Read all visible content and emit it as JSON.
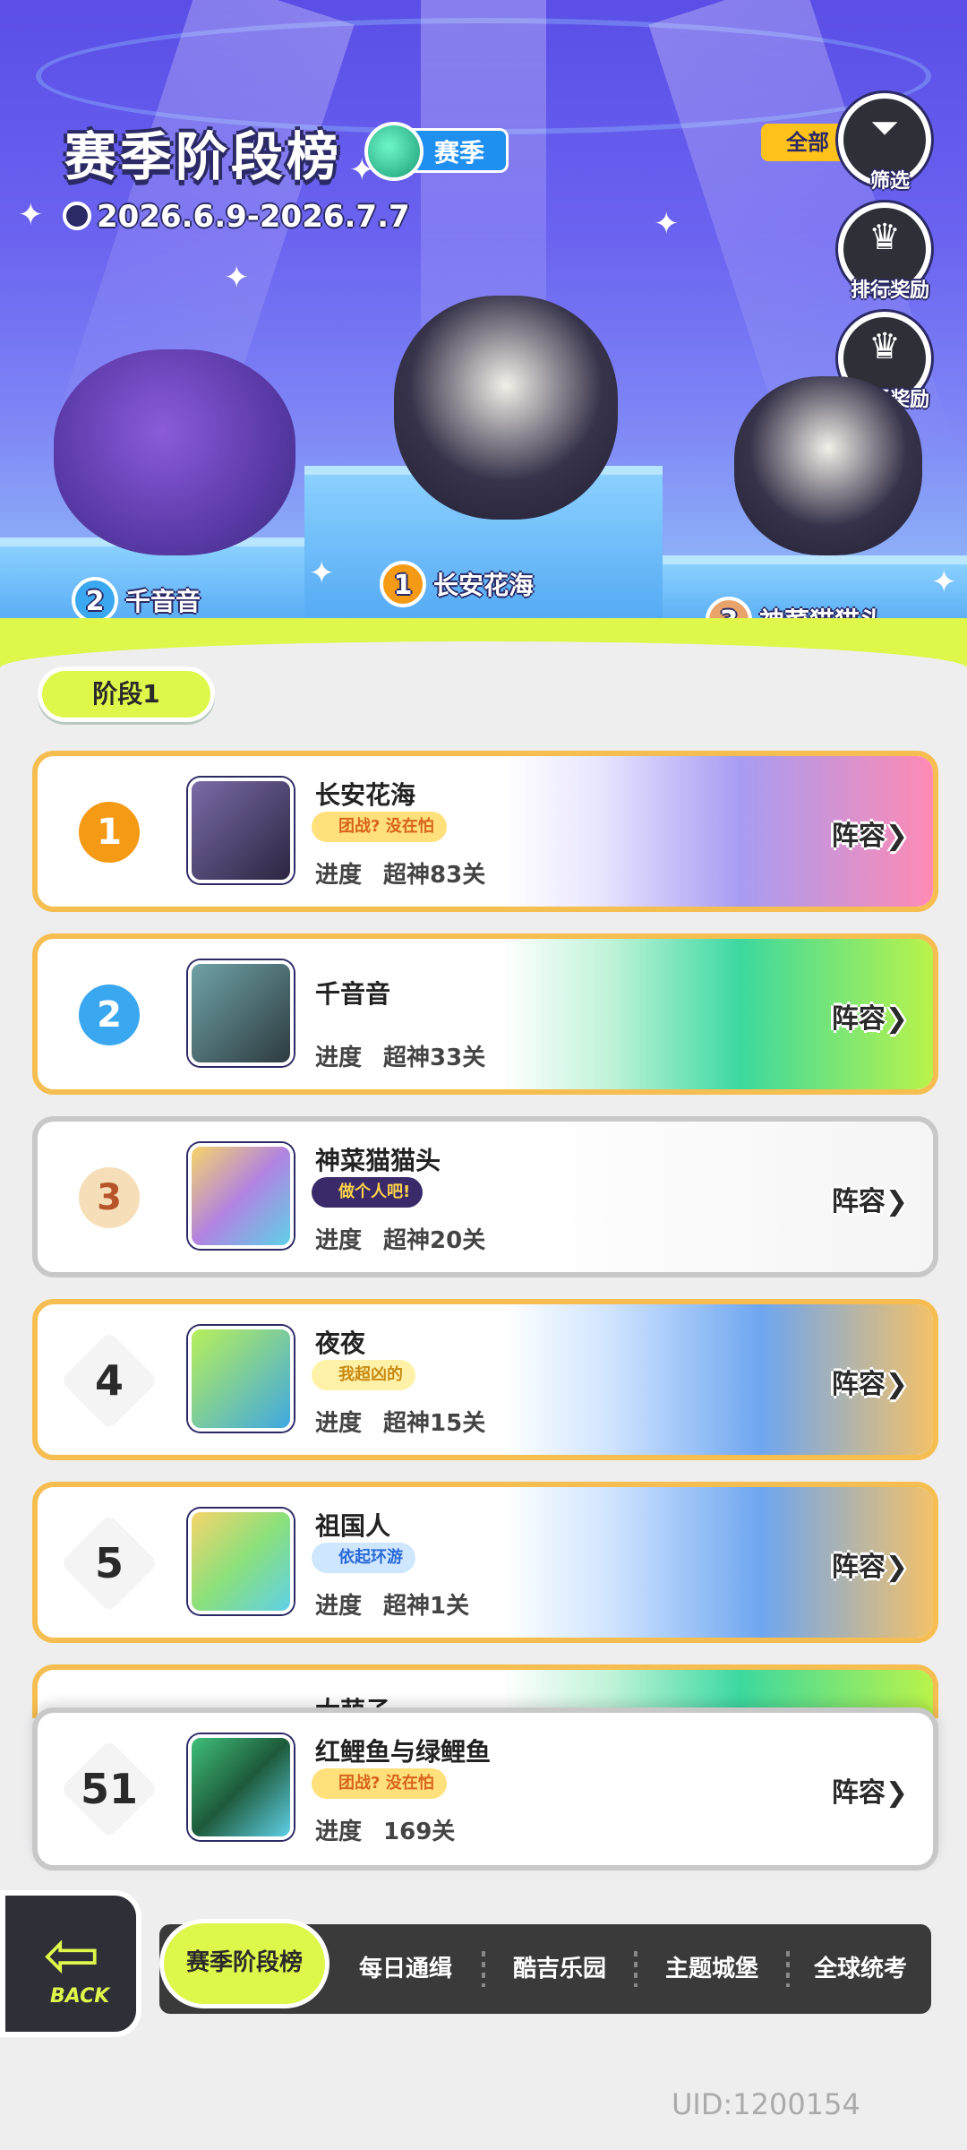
{
  "header": {
    "title": "赛季阶段榜",
    "season_badge": "赛季",
    "date_range": "2026.6.9-2026.7.7"
  },
  "side_buttons": {
    "filter_tag": "全部",
    "filter_label": "筛选",
    "rank_reward_label": "排行奖励",
    "first_clear_reward_label": "首通奖励"
  },
  "podium": {
    "first": {
      "rank": "1",
      "name": "长安花海"
    },
    "second": {
      "rank": "2",
      "name": "千音音"
    },
    "third": {
      "rank": "3",
      "name": "神菜猫猫头"
    }
  },
  "stage_label": "阶段1",
  "leaderboard": {
    "progress_label": "进度",
    "lineup_label": "阵容",
    "rows": [
      {
        "rank": "1",
        "name": "长安花海",
        "tag": "团战? 没在怕",
        "progress": "超神83关"
      },
      {
        "rank": "2",
        "name": "千音音",
        "tag": "",
        "progress": "超神33关"
      },
      {
        "rank": "3",
        "name": "神菜猫猫头",
        "tag": "做个人吧!",
        "progress": "超神20关"
      },
      {
        "rank": "4",
        "name": "夜夜",
        "tag": "我超凶的",
        "progress": "超神15关"
      },
      {
        "rank": "5",
        "name": "祖国人",
        "tag": "依起环游",
        "progress": "超神1关"
      },
      {
        "rank": "",
        "name": "大萌子",
        "tag": "",
        "progress": ""
      }
    ],
    "self_row": {
      "rank": "51",
      "name": "红鲤鱼与绿鲤鱼",
      "tag": "团战? 没在怕",
      "progress": "169关"
    }
  },
  "bottom_nav": {
    "back_label": "BACK",
    "tabs": [
      "赛季阶段榜",
      "每日通缉",
      "酷吉乐园",
      "主题城堡",
      "全球统考"
    ]
  },
  "uid": "UID:1200154",
  "colors": {
    "accent_yellow": "#dff74a",
    "gold_border": "#f6bd50",
    "header_purple": "#5a4ee6"
  }
}
